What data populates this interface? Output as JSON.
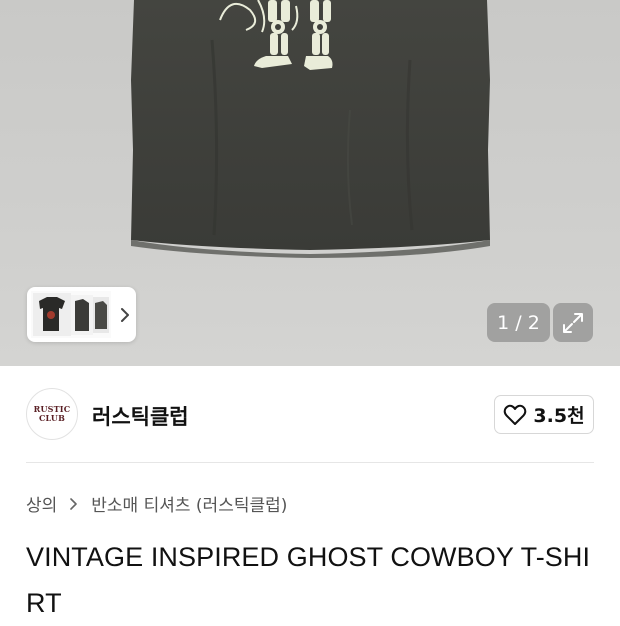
{
  "gallery": {
    "counter": "1 / 2",
    "expand_icon": "expand-icon",
    "thumbnail_chevron_icon": "chevron-right-icon"
  },
  "brand": {
    "logo_line1": "RUSTIC",
    "logo_line2": "CLUB",
    "name": "러스틱클럽"
  },
  "like": {
    "icon": "heart-icon",
    "count": "3.5천"
  },
  "breadcrumb": {
    "items": [
      "상의",
      "반소매 티셔츠 (러스틱클럽)"
    ]
  },
  "product": {
    "title": "VINTAGE INSPIRED GHOST COWBOY T-SHIRT"
  },
  "colors": {
    "shirt": "#3f403c",
    "print": "#e9ecd9"
  }
}
